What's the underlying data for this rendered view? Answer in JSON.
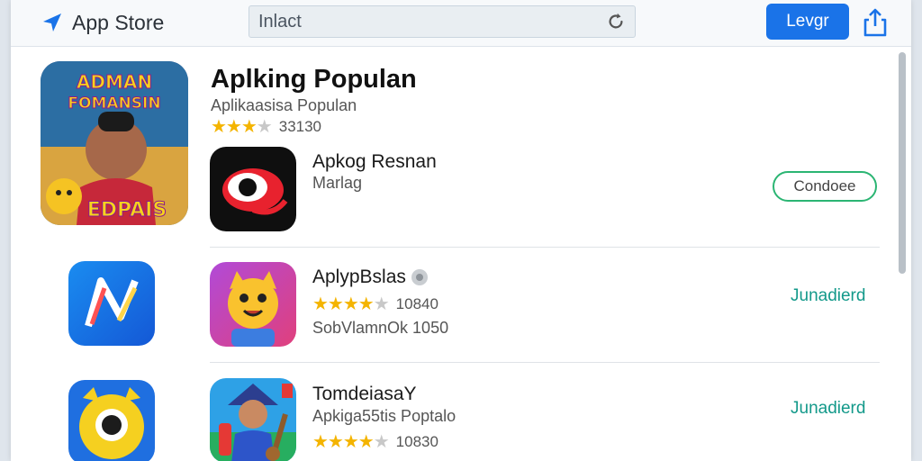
{
  "header": {
    "app_title": "App Store",
    "search_value": "Inlact",
    "action_button": "Levgr"
  },
  "featured": {
    "title": "Aplking Populan",
    "subtitle": "Aplikaasisa Populan",
    "rating": 3.5,
    "rating_count": "33130",
    "art_label_top": "ADMAN",
    "art_label_mid": "FOMANSIN",
    "art_label_bottom": "EDPAIS"
  },
  "apps": [
    {
      "name": "Apkog Resnan",
      "subtitle": "Marlag",
      "action": "Condoee",
      "icon": "red-eye-icon"
    },
    {
      "name": "AplypBslas",
      "subtitle": "SobVlamnOk 1050",
      "rating": 4,
      "rating_count": "10840",
      "action": "Junadierd",
      "icon": "cat-mascot-icon",
      "left_icon": "colorful-n-icon"
    },
    {
      "name": "TomdeiasaY",
      "subtitle": "Apkiga55tis Poptalo",
      "rating": 4,
      "rating_count": "10830",
      "action": "Junadierd",
      "icon": "boy-guitar-icon",
      "left_icon": "yellow-monster-icon"
    }
  ],
  "colors": {
    "accent": "#1a73e8",
    "star": "#f4b400",
    "get_link": "#13998a",
    "outline_button": "#2bb573"
  }
}
